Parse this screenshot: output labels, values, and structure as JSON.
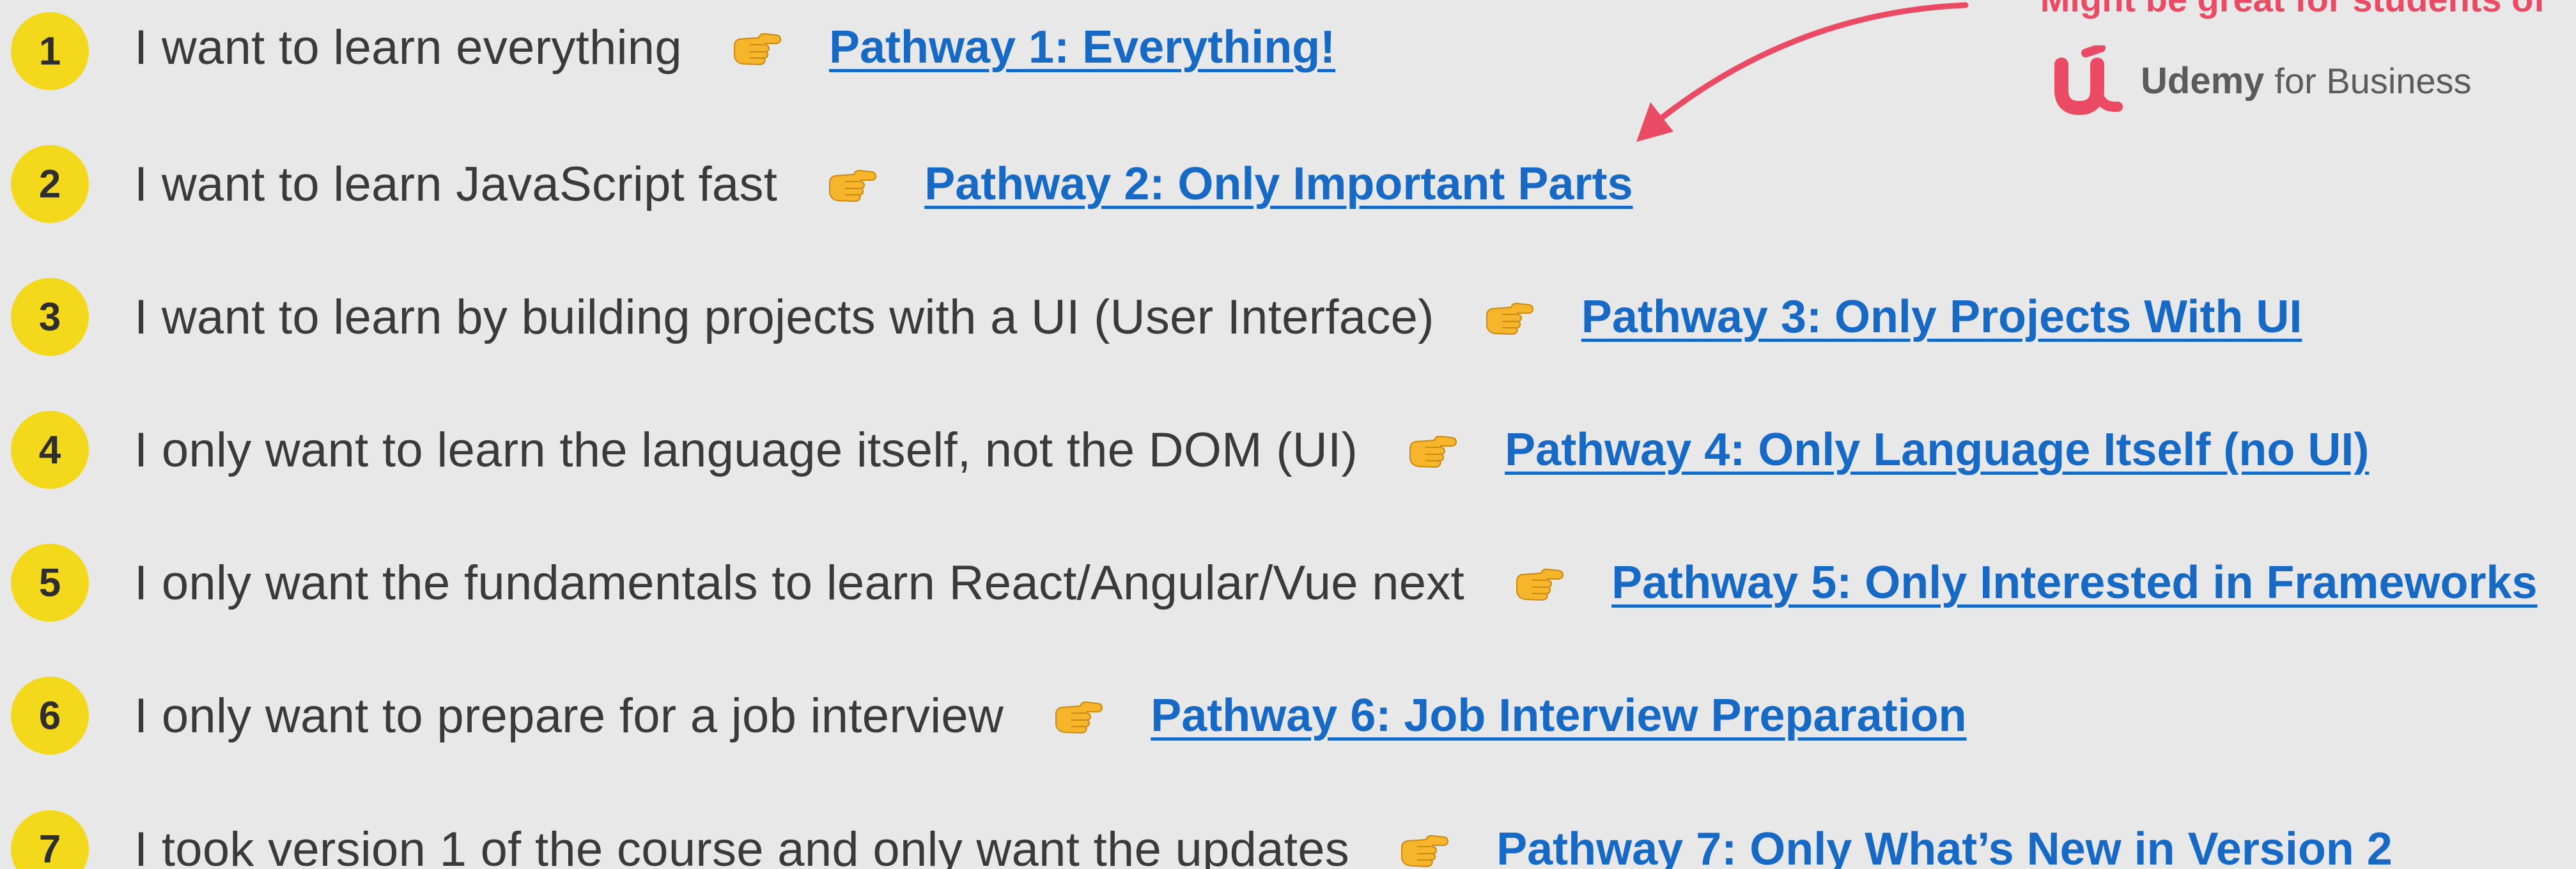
{
  "rows": [
    {
      "number": "1",
      "description": "I want to learn everything",
      "link": "Pathway 1: Everything!"
    },
    {
      "number": "2",
      "description": "I want to learn JavaScript fast",
      "link": "Pathway 2: Only Important Parts"
    },
    {
      "number": "3",
      "description": "I want to learn by building projects with a UI (User Interface)",
      "link": "Pathway 3: Only Projects With UI"
    },
    {
      "number": "4",
      "description": "I only want to learn the language itself, not the DOM (UI)",
      "link": "Pathway 4: Only Language Itself (no UI)"
    },
    {
      "number": "5",
      "description": "I only want the fundamentals to learn React/Angular/Vue next",
      "link": "Pathway 5: Only Interested in Frameworks"
    },
    {
      "number": "6",
      "description": "I only want to prepare for a job interview",
      "link": "Pathway 6: Job Interview Preparation"
    },
    {
      "number": "7",
      "description": "I took version 1 of the course and only want the updates",
      "link": "Pathway 7: Only What’s New in Version 2"
    }
  ],
  "callout": {
    "note": "Might be great for students of",
    "logo_word": "Udemy",
    "logo_suffix": "for Business"
  },
  "icons": {
    "pointer": "backhand-index-pointing-right-icon",
    "logo": "udemy-logo-icon",
    "arrow": "curved-arrow-icon"
  },
  "colors": {
    "background": "#e8e8e8",
    "badge": "#f4d81c",
    "link": "#1769c6",
    "accent": "#ea4a63",
    "text": "#3a3a3a"
  }
}
